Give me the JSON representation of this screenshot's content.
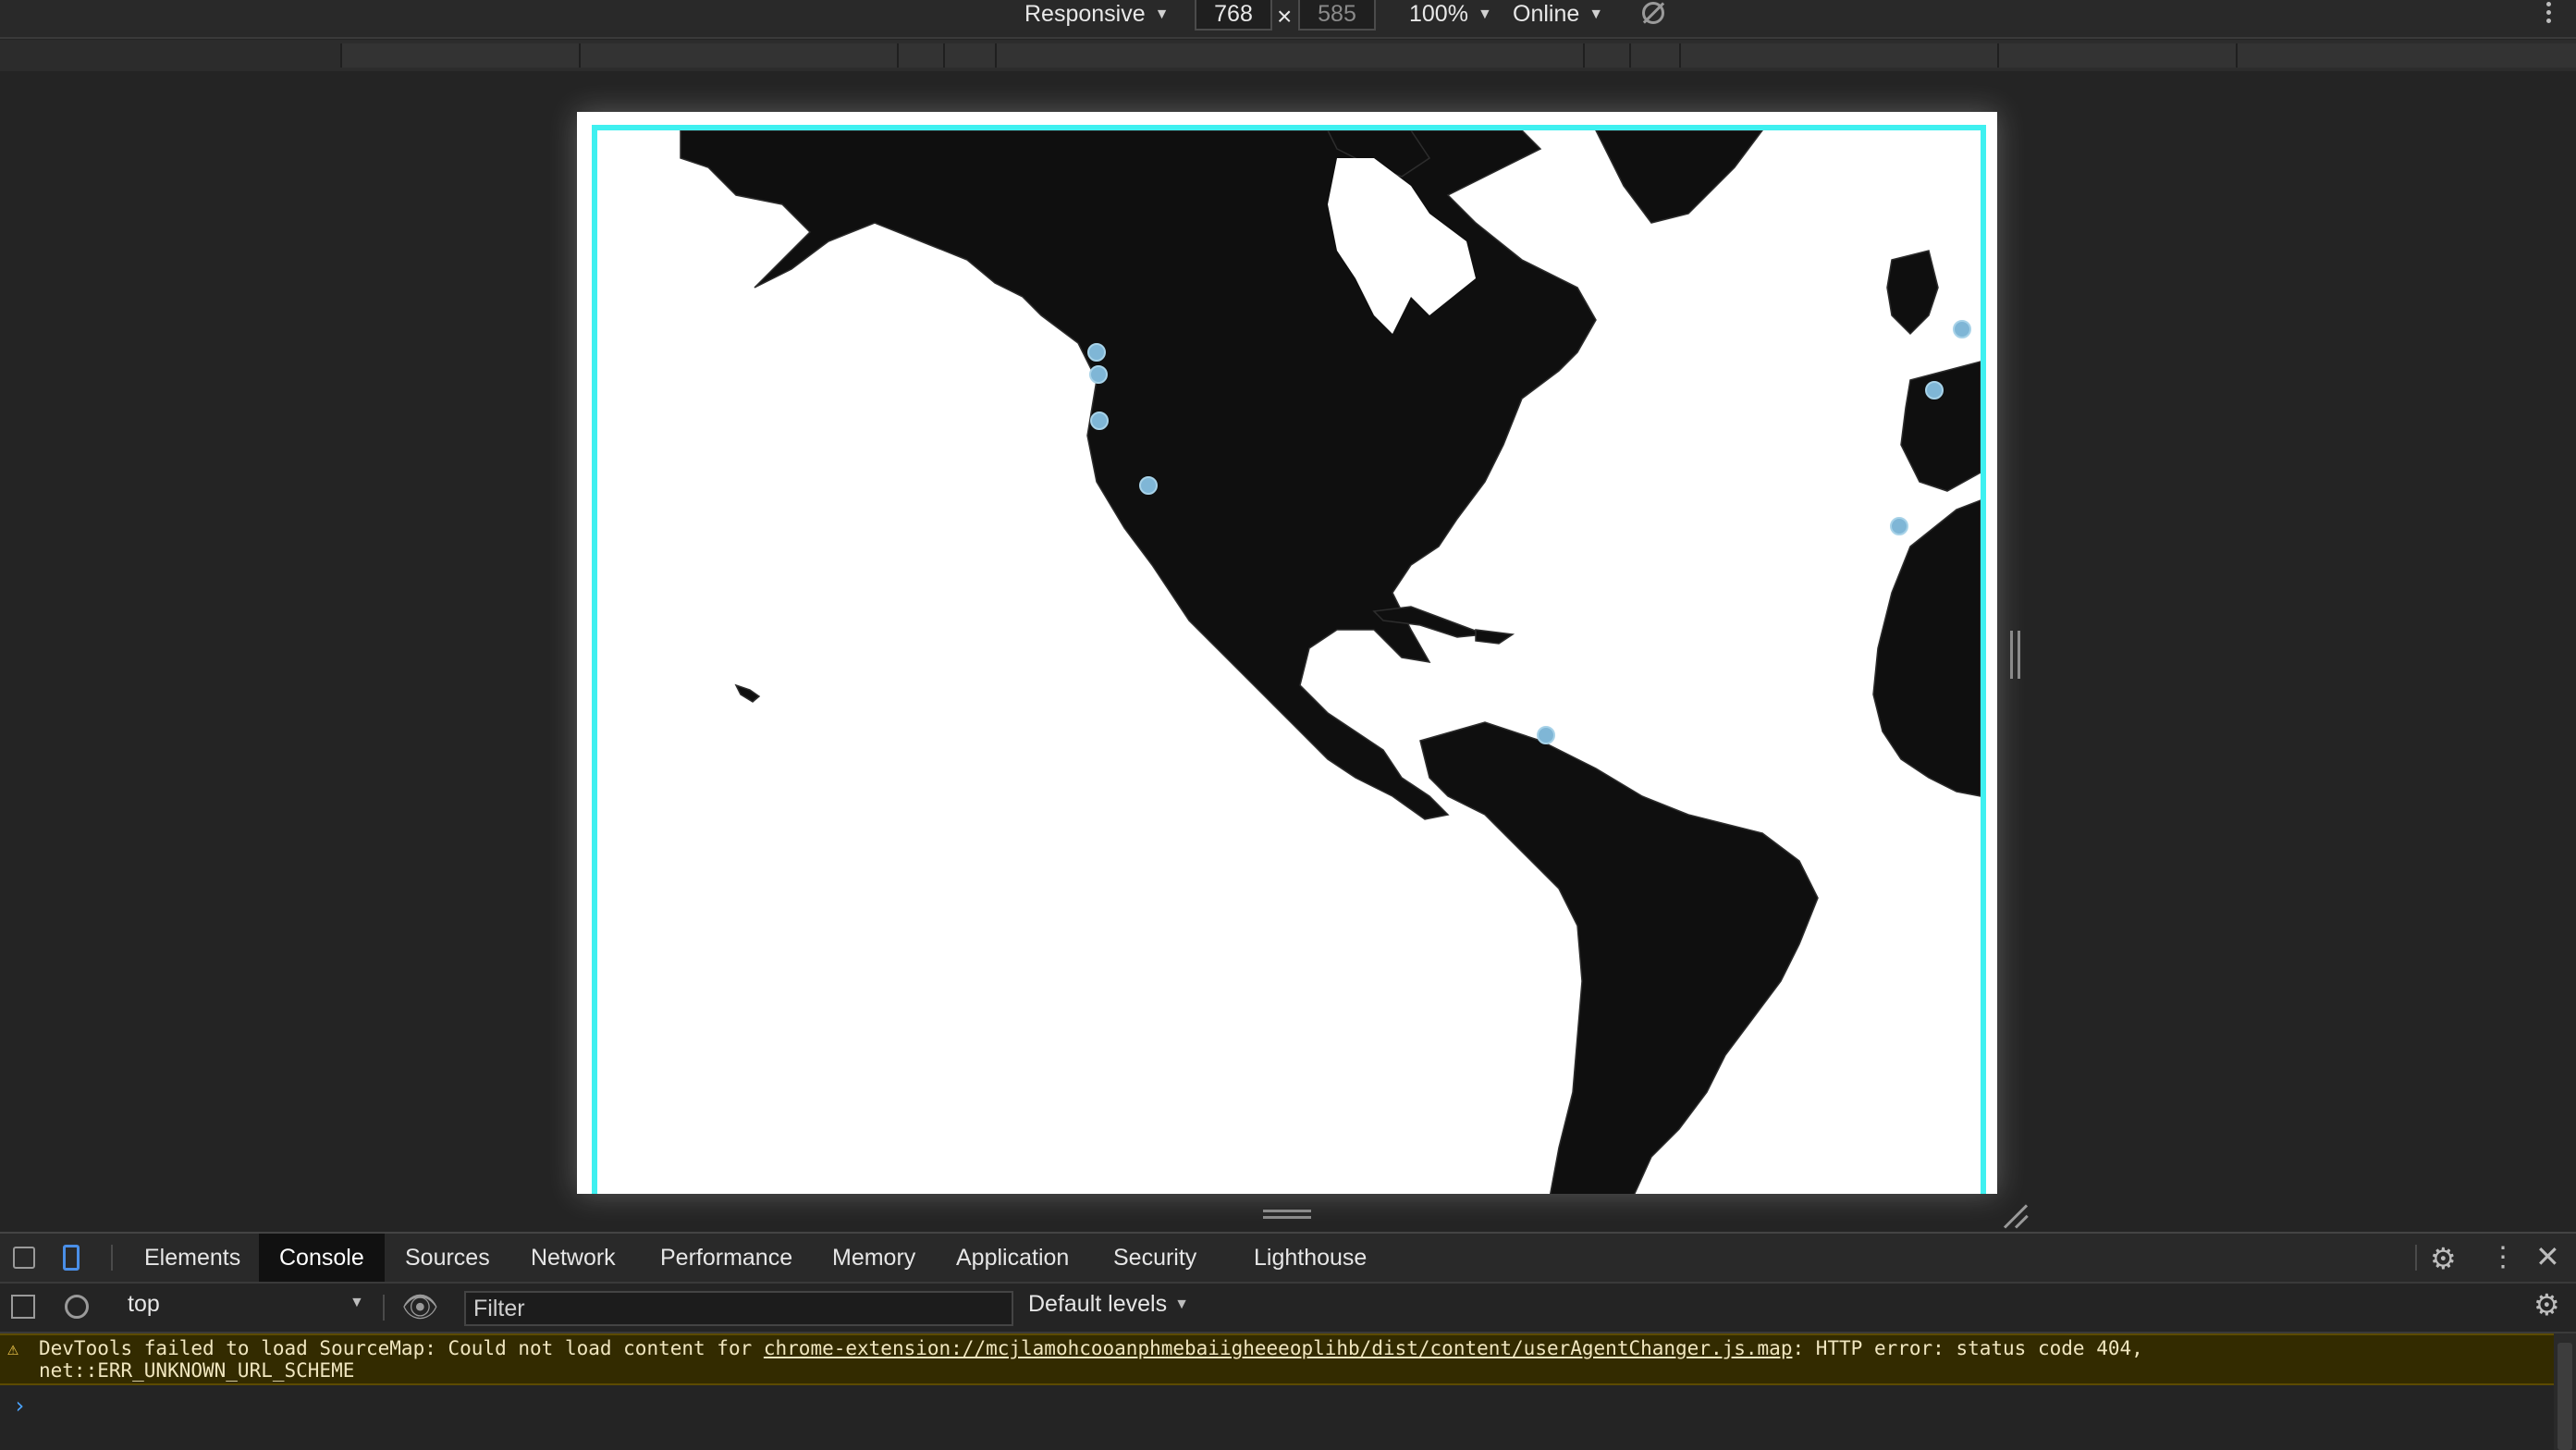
{
  "device_toolbar": {
    "device_mode": "Responsive",
    "width": "768",
    "height": "585",
    "zoom": "100%",
    "throttling": "Online"
  },
  "map": {
    "land_color": "#0f0f0f",
    "ocean_color": "#ffffff",
    "border_color": "#3ff0f0",
    "marker_color": "#7fb6d6"
  },
  "devtools": {
    "tabs": [
      "Elements",
      "Console",
      "Sources",
      "Network",
      "Performance",
      "Memory",
      "Application",
      "Security",
      "Lighthouse"
    ],
    "active_tab": "Console",
    "context": "top",
    "filter_placeholder": "Filter",
    "levels": "Default levels",
    "warning": {
      "prefix": "DevTools failed to load SourceMap: Could not load content for ",
      "url": "chrome-extension://mcjlamohcooanphmebaiigheeeoplihb/dist/content/userAgentChanger.js.map",
      "suffix": ": HTTP error: status code 404,",
      "line2": "net::ERR_UNKNOWN_URL_SCHEME"
    },
    "prompt": "›"
  }
}
